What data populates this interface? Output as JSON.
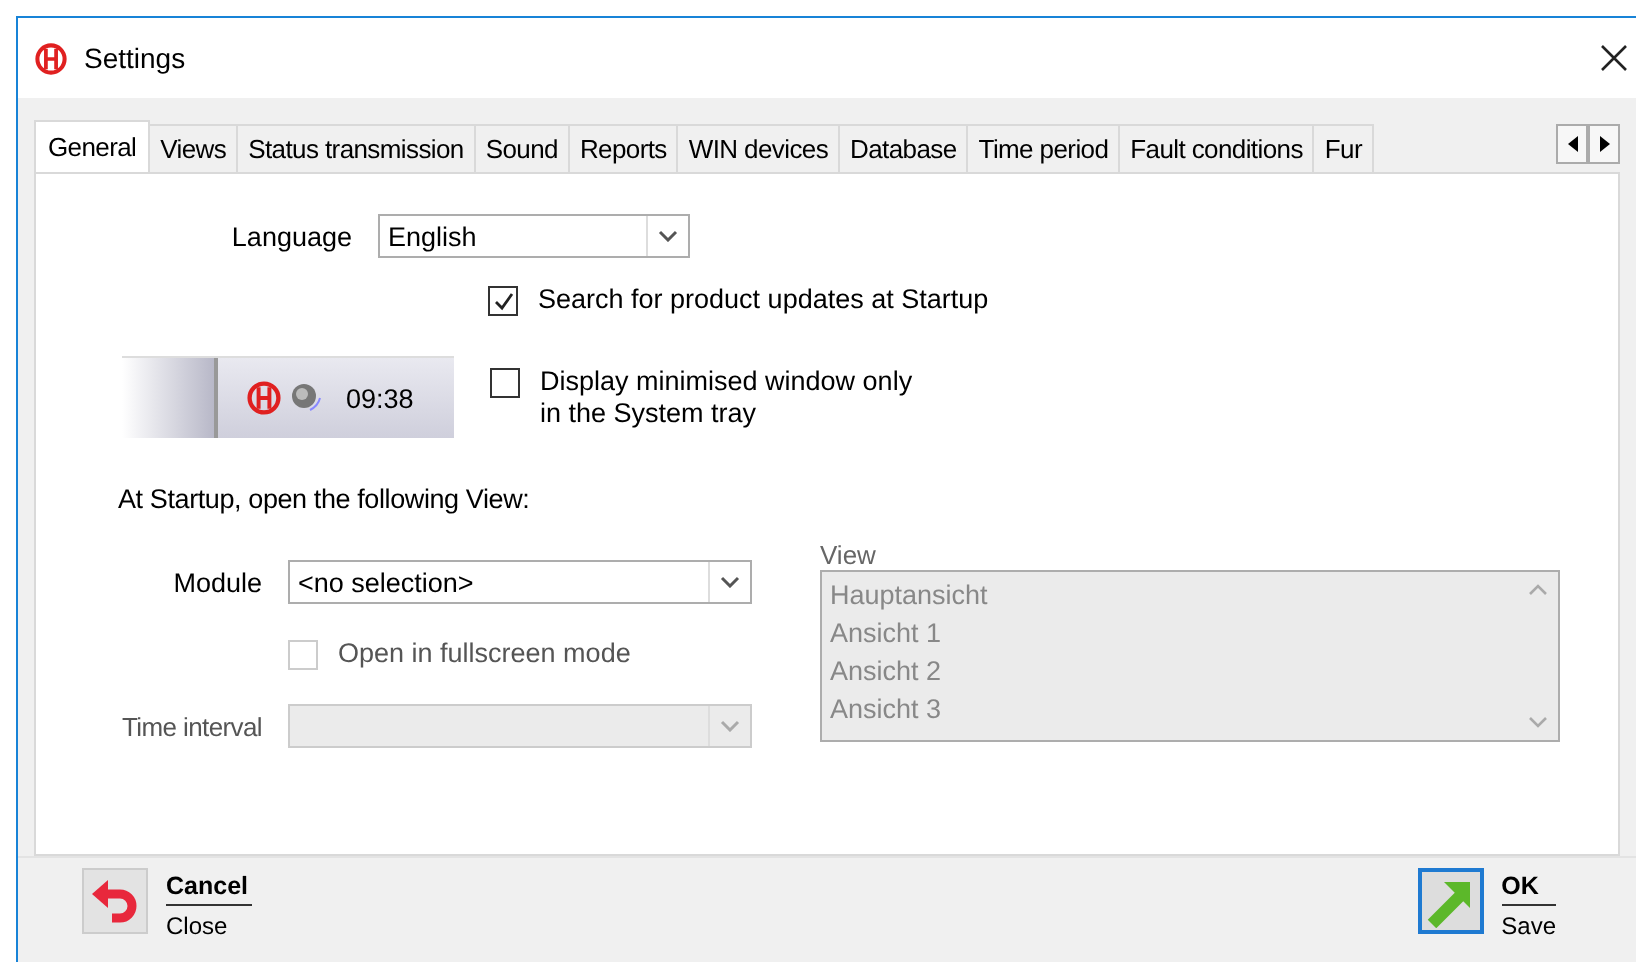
{
  "window": {
    "title": "Settings"
  },
  "tabs": [
    {
      "label": "General",
      "selected": true
    },
    {
      "label": "Views",
      "selected": false
    },
    {
      "label": "Status transmission",
      "selected": false
    },
    {
      "label": "Sound",
      "selected": false
    },
    {
      "label": "Reports",
      "selected": false
    },
    {
      "label": "WIN devices",
      "selected": false
    },
    {
      "label": "Database",
      "selected": false
    },
    {
      "label": "Time period",
      "selected": false
    },
    {
      "label": "Fault conditions",
      "selected": false
    },
    {
      "label": "Fur",
      "selected": false
    }
  ],
  "general": {
    "language": {
      "label": "Language",
      "value": "English"
    },
    "updates": {
      "label": "Search for product updates at Startup",
      "checked": true
    },
    "tray_preview": {
      "time": "09:38"
    },
    "tray": {
      "label": "Display minimised window only in the System tray",
      "checked": false
    },
    "startup_heading": "At Startup, open the following View:",
    "module": {
      "label": "Module",
      "value": "<no selection>",
      "disabled": false
    },
    "fullscreen": {
      "label": "Open in fullscreen mode",
      "checked": false,
      "disabled": true
    },
    "time_interval": {
      "label": "Time interval",
      "disabled": true
    },
    "view": {
      "label": "View",
      "disabled": true,
      "items": [
        "Hauptansicht",
        "Ansicht 1",
        "Ansicht 2",
        "Ansicht 3"
      ]
    }
  },
  "buttons": [
    {
      "kind": "cancel",
      "label": "Cancel",
      "sublabel": "Close",
      "focused": false
    },
    {
      "kind": "ok",
      "label": "OK",
      "sublabel": "Save",
      "focused": true
    }
  ]
}
